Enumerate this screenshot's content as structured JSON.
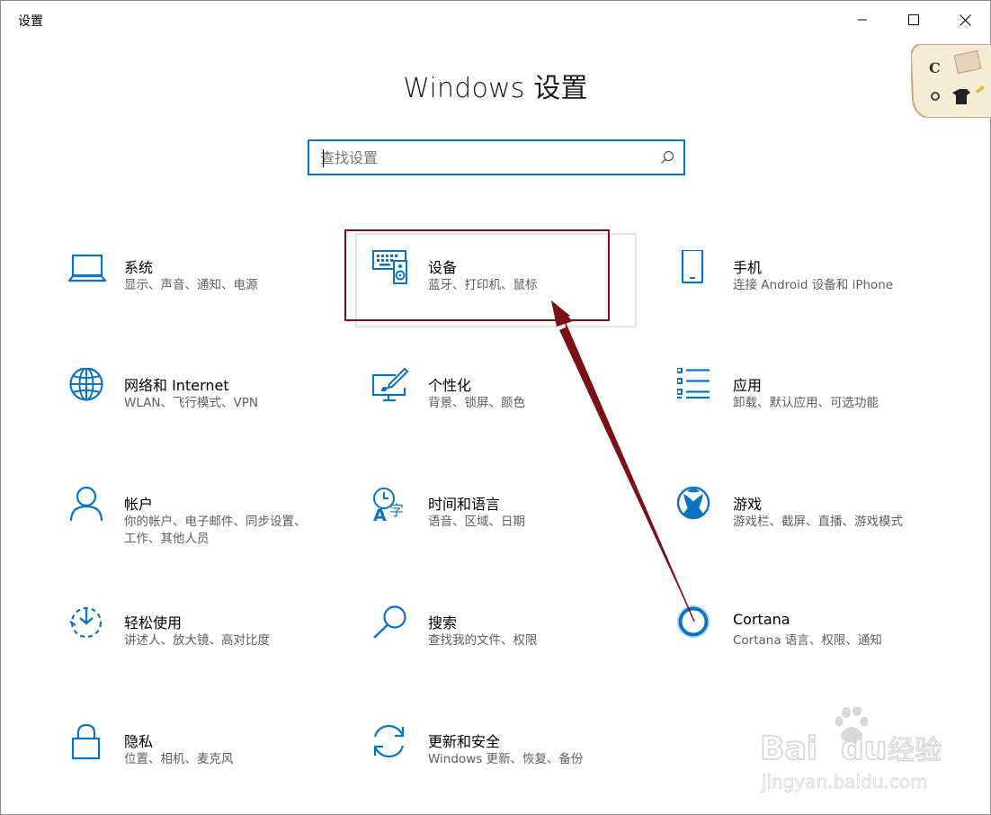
{
  "window": {
    "title": "设置"
  },
  "page": {
    "title": "Windows 设置"
  },
  "search": {
    "placeholder": "查找设置"
  },
  "tiles": [
    {
      "id": "system",
      "name": "系统",
      "desc": "显示、声音、通知、电源",
      "icon": "laptop-icon"
    },
    {
      "id": "devices",
      "name": "设备",
      "desc": "蓝牙、打印机、鼠标",
      "icon": "keyboard-speaker-icon"
    },
    {
      "id": "phone",
      "name": "手机",
      "desc": "连接 Android 设备和 iPhone",
      "icon": "phone-icon"
    },
    {
      "id": "network",
      "name": "网络和 Internet",
      "desc": "WLAN、飞行模式、VPN",
      "icon": "globe-icon"
    },
    {
      "id": "personalization",
      "name": "个性化",
      "desc": "背景、锁屏、颜色",
      "icon": "paint-tablet-icon"
    },
    {
      "id": "apps",
      "name": "应用",
      "desc": "卸载、默认应用、可选功能",
      "icon": "app-list-icon"
    },
    {
      "id": "accounts",
      "name": "帐户",
      "desc": "你的帐户、电子邮件、同步设置、工作、其他人员",
      "icon": "person-icon"
    },
    {
      "id": "time",
      "name": "时间和语言",
      "desc": "语音、区域、日期",
      "icon": "clock-language-icon"
    },
    {
      "id": "gaming",
      "name": "游戏",
      "desc": "游戏栏、截屏、直播、游戏模式",
      "icon": "xbox-icon"
    },
    {
      "id": "ease",
      "name": "轻松使用",
      "desc": "讲述人、放大镜、高对比度",
      "icon": "ease-of-access-icon"
    },
    {
      "id": "search",
      "name": "搜索",
      "desc": "查找我的文件、权限",
      "icon": "magnifier-icon"
    },
    {
      "id": "cortana",
      "name": "Cortana",
      "desc": "Cortana 语言、权限、通知",
      "icon": "cortana-ring-icon"
    },
    {
      "id": "privacy",
      "name": "隐私",
      "desc": "位置、相机、麦克风",
      "icon": "lock-icon"
    },
    {
      "id": "update",
      "name": "更新和安全",
      "desc": "Windows 更新、恢复、备份",
      "icon": "sync-arrows-icon"
    }
  ],
  "colors": {
    "accent": "#0a74c4",
    "annotation": "#7a1117",
    "subtext": "#5d5d5d"
  },
  "watermark": {
    "brand": "Baidu经验",
    "url": "jingyan.baidu.com"
  }
}
